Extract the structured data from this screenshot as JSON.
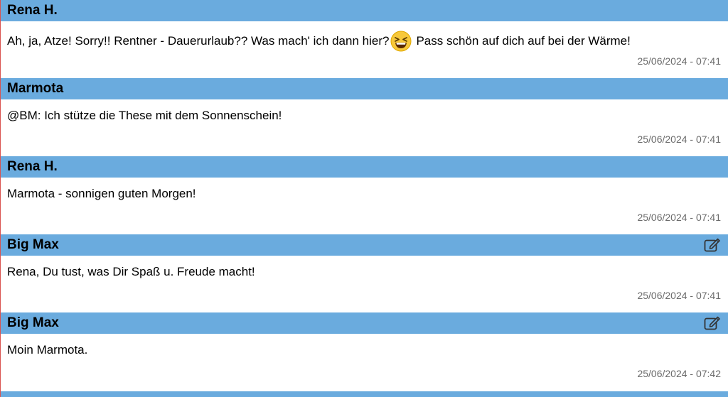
{
  "posts": [
    {
      "author": "Rena H.",
      "message_before": "Ah, ja, Atze! Sorry!! Rentner - Dauerurlaub?? Was mach' ich dann hier?",
      "emoji": "grinning-squinting-face-icon",
      "message_after": "Pass schön auf dich auf bei der Wärme!",
      "timestamp": "25/06/2024 - 07:41",
      "editable": false
    },
    {
      "author": "Marmota",
      "message": "@BM: Ich stütze die These mit dem Sonnenschein!",
      "timestamp": "25/06/2024 - 07:41",
      "editable": false
    },
    {
      "author": "Rena H.",
      "message": "Marmota - sonnigen guten Morgen!",
      "timestamp": "25/06/2024 - 07:41",
      "editable": false
    },
    {
      "author": "Big Max",
      "message": "Rena, Du tust, was Dir Spaß u. Freude macht!",
      "timestamp": "25/06/2024 - 07:41",
      "editable": true,
      "edit_icon": "edit-icon"
    },
    {
      "author": "Big Max",
      "message": "Moin Marmota.",
      "timestamp": "25/06/2024 - 07:42",
      "editable": true,
      "edit_icon": "edit-icon"
    }
  ],
  "colors": {
    "header_bg": "#6aabde",
    "timestamp": "#6b6b6b",
    "left_border": "#d9534f"
  }
}
